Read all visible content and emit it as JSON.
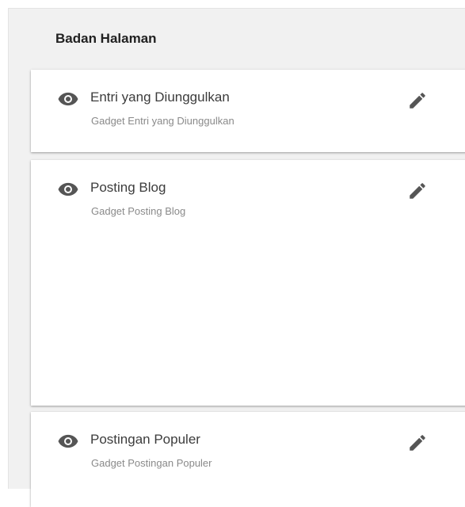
{
  "section": {
    "title": "Badan Halaman"
  },
  "gadgets": [
    {
      "title": "Entri yang Diunggulkan",
      "subtitle": "Gadget Entri yang Diunggulkan",
      "visibility_icon": "eye-icon",
      "edit_icon": "pencil-icon"
    },
    {
      "title": "Posting Blog",
      "subtitle": "Gadget Posting Blog",
      "visibility_icon": "eye-icon",
      "edit_icon": "pencil-icon"
    },
    {
      "title": "Postingan Populer",
      "subtitle": "Gadget Postingan Populer",
      "visibility_icon": "eye-icon",
      "edit_icon": "pencil-icon"
    }
  ],
  "colors": {
    "panel_background": "#f1f1f1",
    "card_background": "#ffffff",
    "icon": "#555555",
    "title_text": "#3c3c3c",
    "subtitle_text": "#8a8a8a"
  }
}
